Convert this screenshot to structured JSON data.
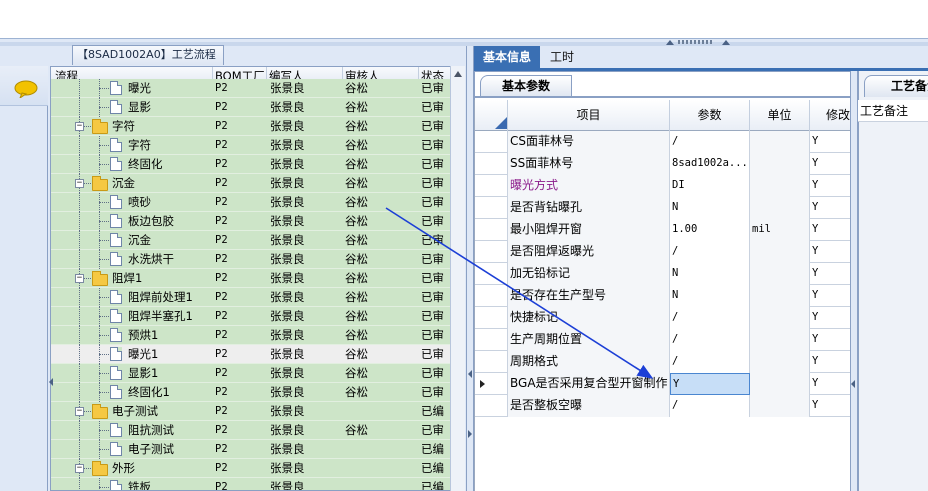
{
  "colors": {
    "tree_row_bg": "#cde5c8",
    "selected_row_bg": "#eeeeee",
    "active_tab_bg": "#3a6fb3",
    "annotation_arrow": "#1c3fd6",
    "purple_text": "#8a1a8a"
  },
  "flow_panel": {
    "title": "【8SAD1002A0】工艺流程",
    "columns": [
      "流程",
      "BOM工厂",
      "编写人",
      "审核人",
      "状态"
    ],
    "rows": [
      {
        "kind": "doc",
        "level": 2,
        "name": "曝光",
        "bom": "P2",
        "writer": "张景良",
        "reviewer": "谷松",
        "status": "已审",
        "selected": false,
        "clipped": true
      },
      {
        "kind": "doc",
        "level": 2,
        "name": "显影",
        "bom": "P2",
        "writer": "张景良",
        "reviewer": "谷松",
        "status": "已审",
        "selected": false
      },
      {
        "kind": "folder",
        "level": 1,
        "name": "字符",
        "bom": "P2",
        "writer": "张景良",
        "reviewer": "谷松",
        "status": "已审",
        "selected": false
      },
      {
        "kind": "doc",
        "level": 2,
        "name": "字符",
        "bom": "P2",
        "writer": "张景良",
        "reviewer": "谷松",
        "status": "已审",
        "selected": false
      },
      {
        "kind": "doc",
        "level": 2,
        "name": "终固化",
        "bom": "P2",
        "writer": "张景良",
        "reviewer": "谷松",
        "status": "已审",
        "selected": false
      },
      {
        "kind": "folder",
        "level": 1,
        "name": "沉金",
        "bom": "P2",
        "writer": "张景良",
        "reviewer": "谷松",
        "status": "已审",
        "selected": false
      },
      {
        "kind": "doc",
        "level": 2,
        "name": "喷砂",
        "bom": "P2",
        "writer": "张景良",
        "reviewer": "谷松",
        "status": "已审",
        "selected": false
      },
      {
        "kind": "doc",
        "level": 2,
        "name": "板边包胶",
        "bom": "P2",
        "writer": "张景良",
        "reviewer": "谷松",
        "status": "已审",
        "selected": false
      },
      {
        "kind": "doc",
        "level": 2,
        "name": "沉金",
        "bom": "P2",
        "writer": "张景良",
        "reviewer": "谷松",
        "status": "已审",
        "selected": false
      },
      {
        "kind": "doc",
        "level": 2,
        "name": "水洗烘干",
        "bom": "P2",
        "writer": "张景良",
        "reviewer": "谷松",
        "status": "已审",
        "selected": false
      },
      {
        "kind": "folder",
        "level": 1,
        "name": "阻焊1",
        "bom": "P2",
        "writer": "张景良",
        "reviewer": "谷松",
        "status": "已审",
        "selected": false
      },
      {
        "kind": "doc",
        "level": 2,
        "name": "阻焊前处理1",
        "bom": "P2",
        "writer": "张景良",
        "reviewer": "谷松",
        "status": "已审",
        "selected": false
      },
      {
        "kind": "doc",
        "level": 2,
        "name": "阻焊半塞孔1",
        "bom": "P2",
        "writer": "张景良",
        "reviewer": "谷松",
        "status": "已审",
        "selected": false
      },
      {
        "kind": "doc",
        "level": 2,
        "name": "预烘1",
        "bom": "P2",
        "writer": "张景良",
        "reviewer": "谷松",
        "status": "已审",
        "selected": false
      },
      {
        "kind": "doc",
        "level": 2,
        "name": "曝光1",
        "bom": "P2",
        "writer": "张景良",
        "reviewer": "谷松",
        "status": "已审",
        "selected": true
      },
      {
        "kind": "doc",
        "level": 2,
        "name": "显影1",
        "bom": "P2",
        "writer": "张景良",
        "reviewer": "谷松",
        "status": "已审",
        "selected": false
      },
      {
        "kind": "doc",
        "level": 2,
        "name": "终固化1",
        "bom": "P2",
        "writer": "张景良",
        "reviewer": "谷松",
        "status": "已审",
        "selected": false
      },
      {
        "kind": "folder",
        "level": 1,
        "name": "电子测试",
        "bom": "P2",
        "writer": "张景良",
        "reviewer": "",
        "status": "已编",
        "selected": false
      },
      {
        "kind": "doc",
        "level": 2,
        "name": "阻抗测试",
        "bom": "P2",
        "writer": "张景良",
        "reviewer": "谷松",
        "status": "已审",
        "selected": false
      },
      {
        "kind": "doc",
        "level": 2,
        "name": "电子测试",
        "bom": "P2",
        "writer": "张景良",
        "reviewer": "",
        "status": "已编",
        "selected": false
      },
      {
        "kind": "folder",
        "level": 1,
        "name": "外形",
        "bom": "P2",
        "writer": "张景良",
        "reviewer": "",
        "status": "已编",
        "selected": false
      },
      {
        "kind": "doc",
        "level": 2,
        "name": "铣板",
        "bom": "P2",
        "writer": "张景良",
        "reviewer": "",
        "status": "已编",
        "selected": false
      }
    ]
  },
  "tabs": {
    "basic_info": "基本信息",
    "work_hours": "工时"
  },
  "basic_params": {
    "subtab_label": "基本参数",
    "columns": [
      "项目",
      "参数",
      "单位",
      "修改"
    ],
    "rows": [
      {
        "item": "CS面菲林号",
        "value": "/",
        "unit": "",
        "modify": "Y",
        "purple": false,
        "current": false
      },
      {
        "item": "SS面菲林号",
        "value": "8sad1002a...",
        "unit": "",
        "modify": "Y",
        "purple": false,
        "current": false
      },
      {
        "item": "曝光方式",
        "value": "DI",
        "unit": "",
        "modify": "Y",
        "purple": true,
        "current": false
      },
      {
        "item": "是否背钻曝孔",
        "value": "N",
        "unit": "",
        "modify": "Y",
        "purple": false,
        "current": false
      },
      {
        "item": "最小阻焊开窗",
        "value": "1.00",
        "unit": "mil",
        "modify": "Y",
        "purple": false,
        "current": false
      },
      {
        "item": "是否阻焊返曝光",
        "value": "/",
        "unit": "",
        "modify": "Y",
        "purple": false,
        "current": false
      },
      {
        "item": "加无铅标记",
        "value": "N",
        "unit": "",
        "modify": "Y",
        "purple": false,
        "current": false
      },
      {
        "item": "是否存在生产型号",
        "value": "N",
        "unit": "",
        "modify": "Y",
        "purple": false,
        "current": false
      },
      {
        "item": "快捷标记",
        "value": "/",
        "unit": "",
        "modify": "Y",
        "purple": false,
        "current": false
      },
      {
        "item": "生产周期位置",
        "value": "/",
        "unit": "",
        "modify": "Y",
        "purple": false,
        "current": false
      },
      {
        "item": "周期格式",
        "value": "/",
        "unit": "",
        "modify": "Y",
        "purple": false,
        "current": false
      },
      {
        "item": "BGA是否采用复合型开窗制作",
        "value": "Y",
        "unit": "",
        "modify": "Y",
        "purple": false,
        "current": true
      },
      {
        "item": "是否整板空曝",
        "value": "/",
        "unit": "",
        "modify": "Y",
        "purple": false,
        "current": false
      }
    ]
  },
  "remark_panel": {
    "tab_label": "工艺备注",
    "field_label": "工艺备注"
  },
  "icons": {
    "chat": "chat-bubble-icon",
    "folder": "folder-icon",
    "document": "document-icon",
    "row_pointer": "row-pointer-icon"
  }
}
